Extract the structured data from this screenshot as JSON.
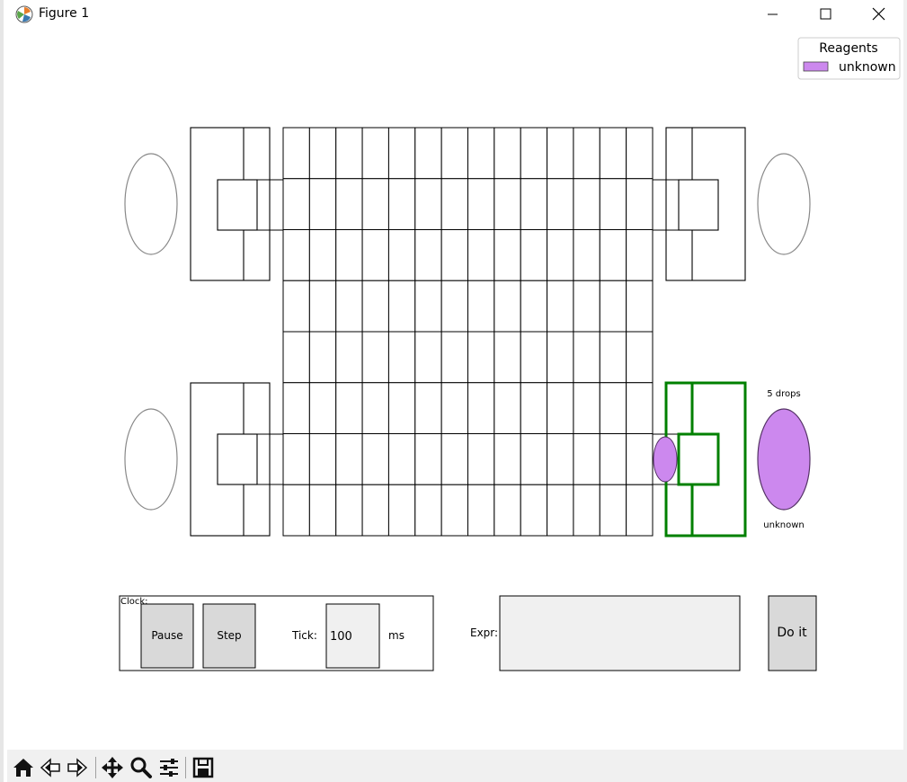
{
  "window": {
    "title": "Figure 1"
  },
  "legend": {
    "title": "Reagents",
    "items": [
      {
        "label": "unknown",
        "color": "#cc88ee"
      }
    ]
  },
  "board": {
    "reagent_color": "#cc88ee",
    "selected_color": "#008000",
    "reservoir": {
      "drops_label": "5 drops",
      "name_label": "unknown"
    }
  },
  "controls": {
    "clock_label": "Clock:",
    "pause_label": "Pause",
    "step_label": "Step",
    "tick_label": "Tick:",
    "tick_value": "100",
    "tick_unit": "ms",
    "expr_label": "Expr:",
    "expr_value": "",
    "do_it_label": "Do it"
  },
  "toolbar": {
    "icons": [
      "home-icon",
      "back-icon",
      "forward-icon",
      "pan-icon",
      "zoom-icon",
      "configure-icon",
      "save-icon"
    ]
  }
}
